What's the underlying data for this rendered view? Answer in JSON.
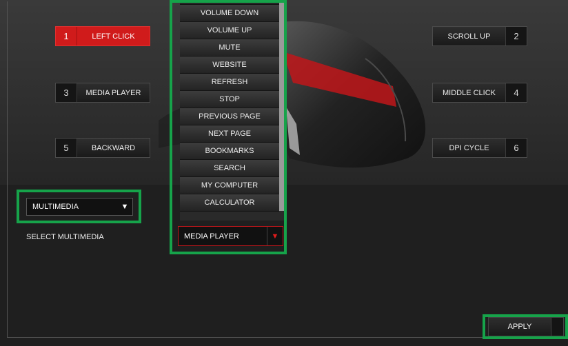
{
  "buttons": {
    "b1": {
      "num": "1",
      "label": "LEFT CLICK"
    },
    "b2": {
      "num": "2",
      "label": "SCROLL UP"
    },
    "b3": {
      "num": "3",
      "label": "MEDIA PLAYER"
    },
    "b4": {
      "num": "4",
      "label": "MIDDLE CLICK"
    },
    "b5": {
      "num": "5",
      "label": "BACKWARD"
    },
    "b6": {
      "num": "6",
      "label": "DPI CYCLE"
    }
  },
  "function_select": {
    "value": "MULTIMEDIA",
    "arrow": "▼"
  },
  "multimedia_label": "SELECT MULTIMEDIA",
  "multimedia_select": {
    "value": "MEDIA PLAYER",
    "arrow": "▼"
  },
  "dropdown_items": [
    "VOLUME DOWN",
    "VOLUME UP",
    "MUTE",
    "WEBSITE",
    "REFRESH",
    "STOP",
    "PREVIOUS PAGE",
    "NEXT PAGE",
    "BOOKMARKS",
    "SEARCH",
    "MY COMPUTER",
    "CALCULATOR"
  ],
  "apply_label": "APPLY",
  "colors": {
    "accent": "#d01b1b",
    "highlight": "#16a34a"
  }
}
